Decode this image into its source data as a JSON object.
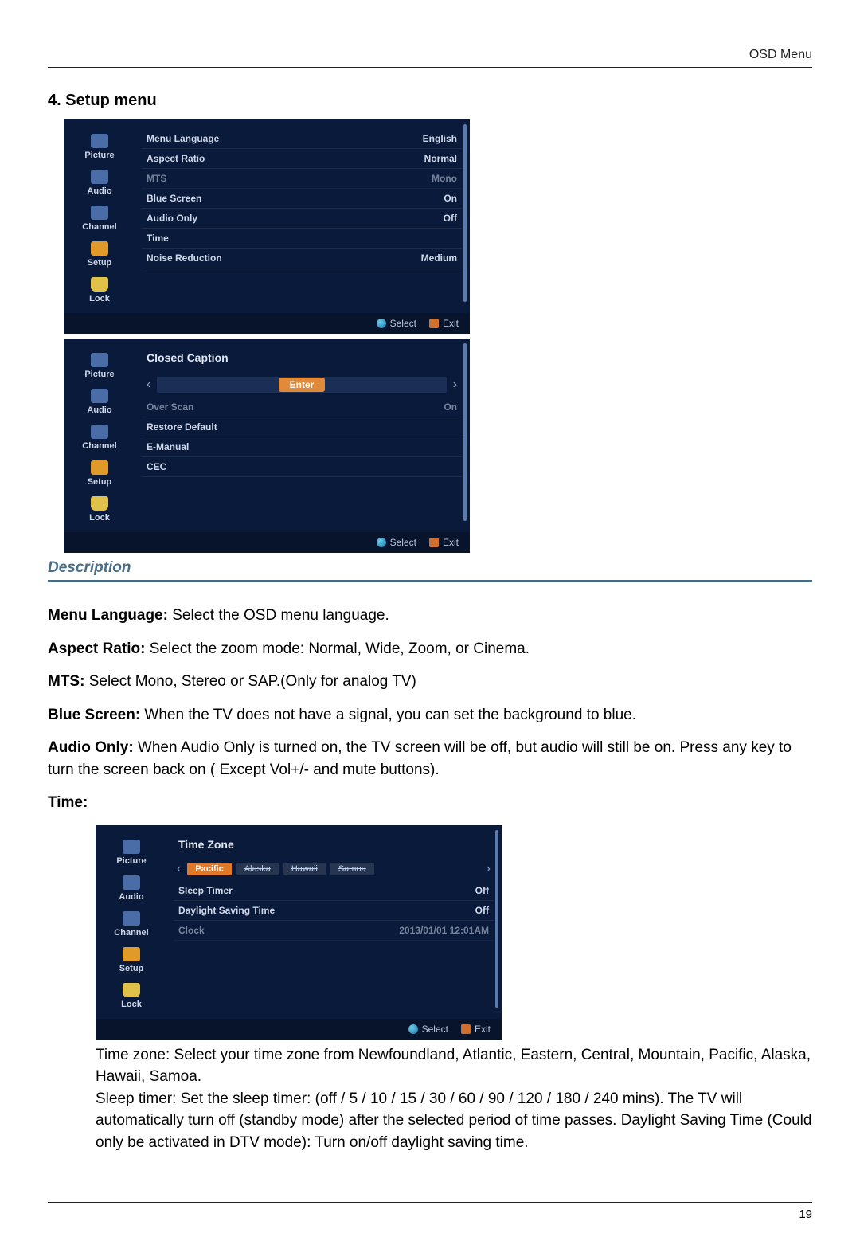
{
  "header": {
    "doc_section": "OSD Menu"
  },
  "title": "4. Setup menu",
  "sidebar": {
    "items": [
      {
        "label": "Picture"
      },
      {
        "label": "Audio"
      },
      {
        "label": "Channel"
      },
      {
        "label": "Setup"
      },
      {
        "label": "Lock"
      }
    ]
  },
  "osd1": {
    "rows": [
      {
        "label": "Menu Language",
        "value": "English"
      },
      {
        "label": "Aspect Ratio",
        "value": "Normal"
      },
      {
        "label": "MTS",
        "value": "Mono",
        "dim": true
      },
      {
        "label": "Blue Screen",
        "value": "On"
      },
      {
        "label": "Audio Only",
        "value": "Off"
      },
      {
        "label": "Time",
        "value": ""
      },
      {
        "label": "Noise Reduction",
        "value": "Medium"
      }
    ],
    "footer": {
      "select": "Select",
      "exit": "Exit"
    }
  },
  "osd2": {
    "heading": "Closed Caption",
    "enter": "Enter",
    "rows": [
      {
        "label": "Over Scan",
        "value": "On",
        "dim": true
      },
      {
        "label": "Restore Default",
        "value": ""
      },
      {
        "label": "E-Manual",
        "value": ""
      },
      {
        "label": "CEC",
        "value": ""
      }
    ],
    "footer": {
      "select": "Select",
      "exit": "Exit"
    }
  },
  "description": {
    "title": "Description",
    "items": [
      {
        "label": "Menu Language:",
        "text": " Select the OSD menu language."
      },
      {
        "label": "Aspect Ratio:",
        "text": " Select the zoom mode: Normal, Wide, Zoom, or Cinema."
      },
      {
        "label": "MTS:",
        "text": " Select Mono, Stereo or SAP.(Only for analog TV)"
      },
      {
        "label": "Blue Screen:",
        "text": " When the TV does not have a signal, you can set the background to blue."
      },
      {
        "label": "Audio Only:",
        "text": " When Audio Only is turned on, the TV screen will be off, but audio will still be on. Press any key to turn the screen back on ( Except Vol+/- and mute buttons)."
      },
      {
        "label": "Time:",
        "text": ""
      }
    ]
  },
  "osd3": {
    "heading": "Time Zone",
    "carousel": {
      "active": "Pacific",
      "ghosts": [
        "Alaska",
        "Hawaii",
        "Samoa"
      ]
    },
    "rows": [
      {
        "label": "Sleep Timer",
        "value": "Off"
      },
      {
        "label": "Daylight Saving Time",
        "value": "Off"
      },
      {
        "label": "Clock",
        "value": "2013/01/01 12:01AM",
        "dim": true
      }
    ],
    "footer": {
      "select": "Select",
      "exit": "Exit"
    }
  },
  "time_text": {
    "p1": "Time zone: Select your time zone from Newfoundland,  Atlantic, Eastern, Central, Mountain, Pacific, Alaska, Hawaii, Samoa.",
    "p2": "Sleep timer: Set the sleep timer: (off / 5 / 10 / 15 / 30 / 60 / 90 / 120 / 180 / 240 mins). The TV will automatically turn off (standby mode) after the selected period of time passes. Daylight Saving Time (Could only be activated in DTV mode): Turn on/off daylight saving time."
  },
  "page_number": "19"
}
